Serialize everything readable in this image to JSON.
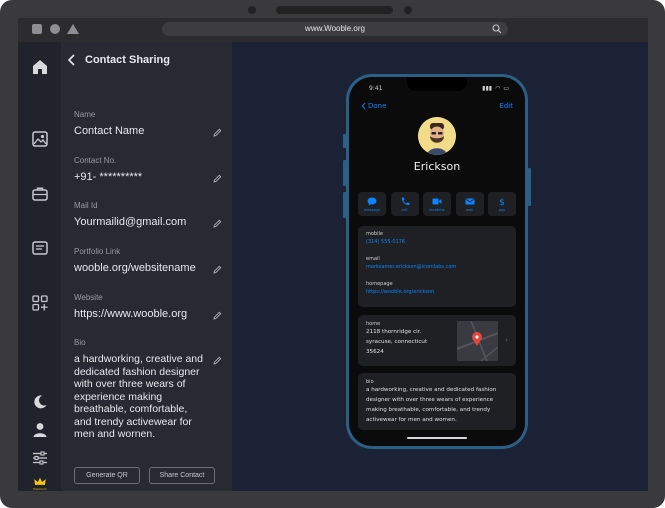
{
  "browser": {
    "url": "www.Wooble.org"
  },
  "panel": {
    "title": "Contact Sharing",
    "fields": [
      {
        "label": "Name",
        "value": "Contact Name"
      },
      {
        "label": "Contact No.",
        "value": "+91- **********"
      },
      {
        "label": "Mail Id",
        "value": "Yourmailid@gmail.com"
      },
      {
        "label": "Portfolio Link",
        "value": "wooble.org/websitename"
      },
      {
        "label": "Website",
        "value": "https://www.wooble.org"
      },
      {
        "label": "Bio",
        "value": "a hardworking, creative and dedicated fashion designer with over three wears of experience making breathable, comfortable, and trendy activewear for men and wornen."
      }
    ],
    "buttons": {
      "generate_qr": "Generate QR",
      "share_contact": "Share Contact"
    }
  },
  "rail": {
    "icons": [
      "home-icon",
      "gallery-icon",
      "briefcase-icon",
      "card-icon",
      "apps-add-icon",
      "moon-icon",
      "user-icon",
      "sliders-icon",
      "crown-icon"
    ],
    "crown_label": "Premium"
  },
  "phone": {
    "status_time": "9:41",
    "nav": {
      "back": "Done",
      "edit": "Edit"
    },
    "contact_name": "Erickson",
    "actions": [
      "message",
      "call",
      "facetime",
      "mail",
      "pay"
    ],
    "info": {
      "mobile_label": "mobile",
      "mobile_value": "(314) 555-0176",
      "email_label": "email",
      "email_value": "marksamer.erickson@icomlabs.com",
      "homepage_label": "homepage",
      "homepage_value": "https://wooble.org/erickson"
    },
    "address": {
      "label": "home",
      "line1": "2118 thornridge cir.",
      "line2": "syracuse, connecticut",
      "line3": "35624"
    },
    "bio": {
      "label": "bio",
      "text": "a hardworking, creative and dedicated fashion designer with over three wears of experience making breathable, comfortable, and trendy activewear for men and women."
    }
  },
  "colors": {
    "accent": "#0a84ff",
    "phone_frame": "#2c5f86",
    "panel_bg": "#272a33",
    "main_bg": "#1c2236",
    "crown": "#f5c518"
  }
}
